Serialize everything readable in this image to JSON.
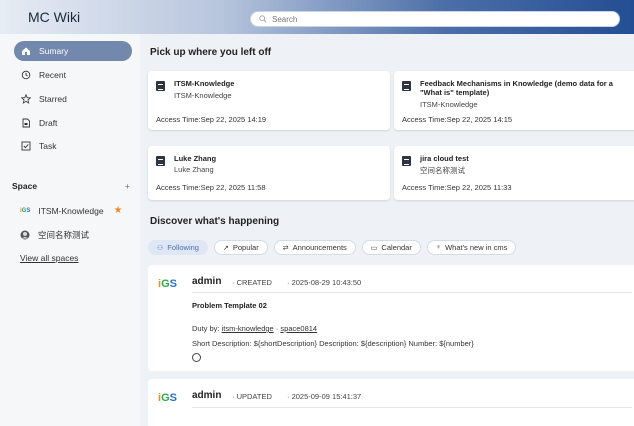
{
  "header": {
    "title": "MC Wiki",
    "search_placeholder": "Search"
  },
  "sidebar": {
    "items": [
      {
        "label": "Sumary",
        "icon": "home-icon"
      },
      {
        "label": "Recent",
        "icon": "history-icon"
      },
      {
        "label": "Starred",
        "icon": "star-outline-icon"
      },
      {
        "label": "Draft",
        "icon": "draft-icon"
      },
      {
        "label": "Task",
        "icon": "checkbox-icon"
      }
    ],
    "space_header": "Space",
    "space_add": "+",
    "spaces": [
      {
        "label": "ITSM-Knowledge",
        "starred": true
      },
      {
        "label": "空间名称测试",
        "starred": false
      }
    ],
    "view_all": "View all spaces"
  },
  "main": {
    "recent_title": "Pick up where you left off",
    "cards": [
      {
        "title": "ITSM-Knowledge",
        "space": "ITSM-Knowledge",
        "time": "Access Time:Sep 22, 2025 14:19"
      },
      {
        "title": "Feedback Mechanisms in Knowledge (demo data for a \"What is\" template)",
        "space": "ITSM-Knowledge",
        "time": "Access Time:Sep 22, 2025 14:15"
      },
      {
        "title": "Luke Zhang",
        "space": "Luke Zhang",
        "time": "Access Time:Sep 22, 2025 11:58"
      },
      {
        "title": "jira cloud test",
        "space": "空间名称测试",
        "time": "Access Time:Sep 22, 2025 11:33"
      }
    ],
    "discover_title": "Discover what's happening",
    "filters": [
      {
        "label": "Following",
        "icon": "users-icon"
      },
      {
        "label": "Popular",
        "icon": "trend-icon"
      },
      {
        "label": "Announcements",
        "icon": "megaphone-icon"
      },
      {
        "label": "Calendar",
        "icon": "calendar-icon"
      },
      {
        "label": "What's new in cms",
        "icon": "bulb-icon"
      }
    ],
    "feed": [
      {
        "author": "admin",
        "action": "· CREATED",
        "time": "· 2025-08-29 10:43:50",
        "title": "Problem Template 02",
        "duty_prefix": "Duty by:",
        "duty_user": "itsm-knowledge",
        "duty_dot": "·",
        "duty_space": "space0814",
        "description": "Short Description: ${shortDescription} Description: ${description} Number: ${number}"
      },
      {
        "author": "admin",
        "action": "· UPDATED",
        "time": "· 2025-09-09 15:41:37"
      }
    ]
  },
  "colors": {
    "accent": "#7388ad",
    "star": "#f08a2a",
    "topbar_dark": "#244e93"
  }
}
